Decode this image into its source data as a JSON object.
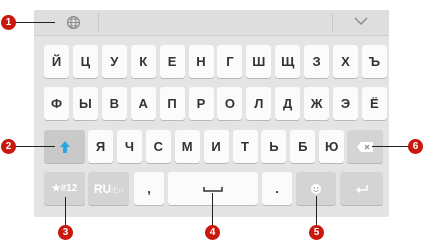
{
  "keyboard": {
    "row1": [
      "Й",
      "Ц",
      "У",
      "К",
      "Е",
      "Н",
      "Г",
      "Ш",
      "Щ",
      "З",
      "Х",
      "Ъ"
    ],
    "row2": [
      "Ф",
      "Ы",
      "В",
      "А",
      "П",
      "Р",
      "О",
      "Л",
      "Д",
      "Ж",
      "Э",
      "Ё"
    ],
    "row3": [
      "Я",
      "Ч",
      "С",
      "М",
      "И",
      "Т",
      "Ь",
      "Б",
      "Ю"
    ],
    "symbols_label": "★#12",
    "lang_main": "RU",
    "lang_sub": "/En",
    "comma": ",",
    "period": "."
  },
  "callouts": [
    "1",
    "2",
    "3",
    "4",
    "5",
    "6"
  ],
  "colors": {
    "accent": "#2aa7e0",
    "callout": "#c9180e",
    "key_mod": "#d4d4d4"
  },
  "icons": [
    "globe-icon",
    "chevron-down-icon",
    "shift-arrow-icon",
    "space-bar-icon",
    "emoji-icon",
    "backspace-icon",
    "enter-icon"
  ]
}
